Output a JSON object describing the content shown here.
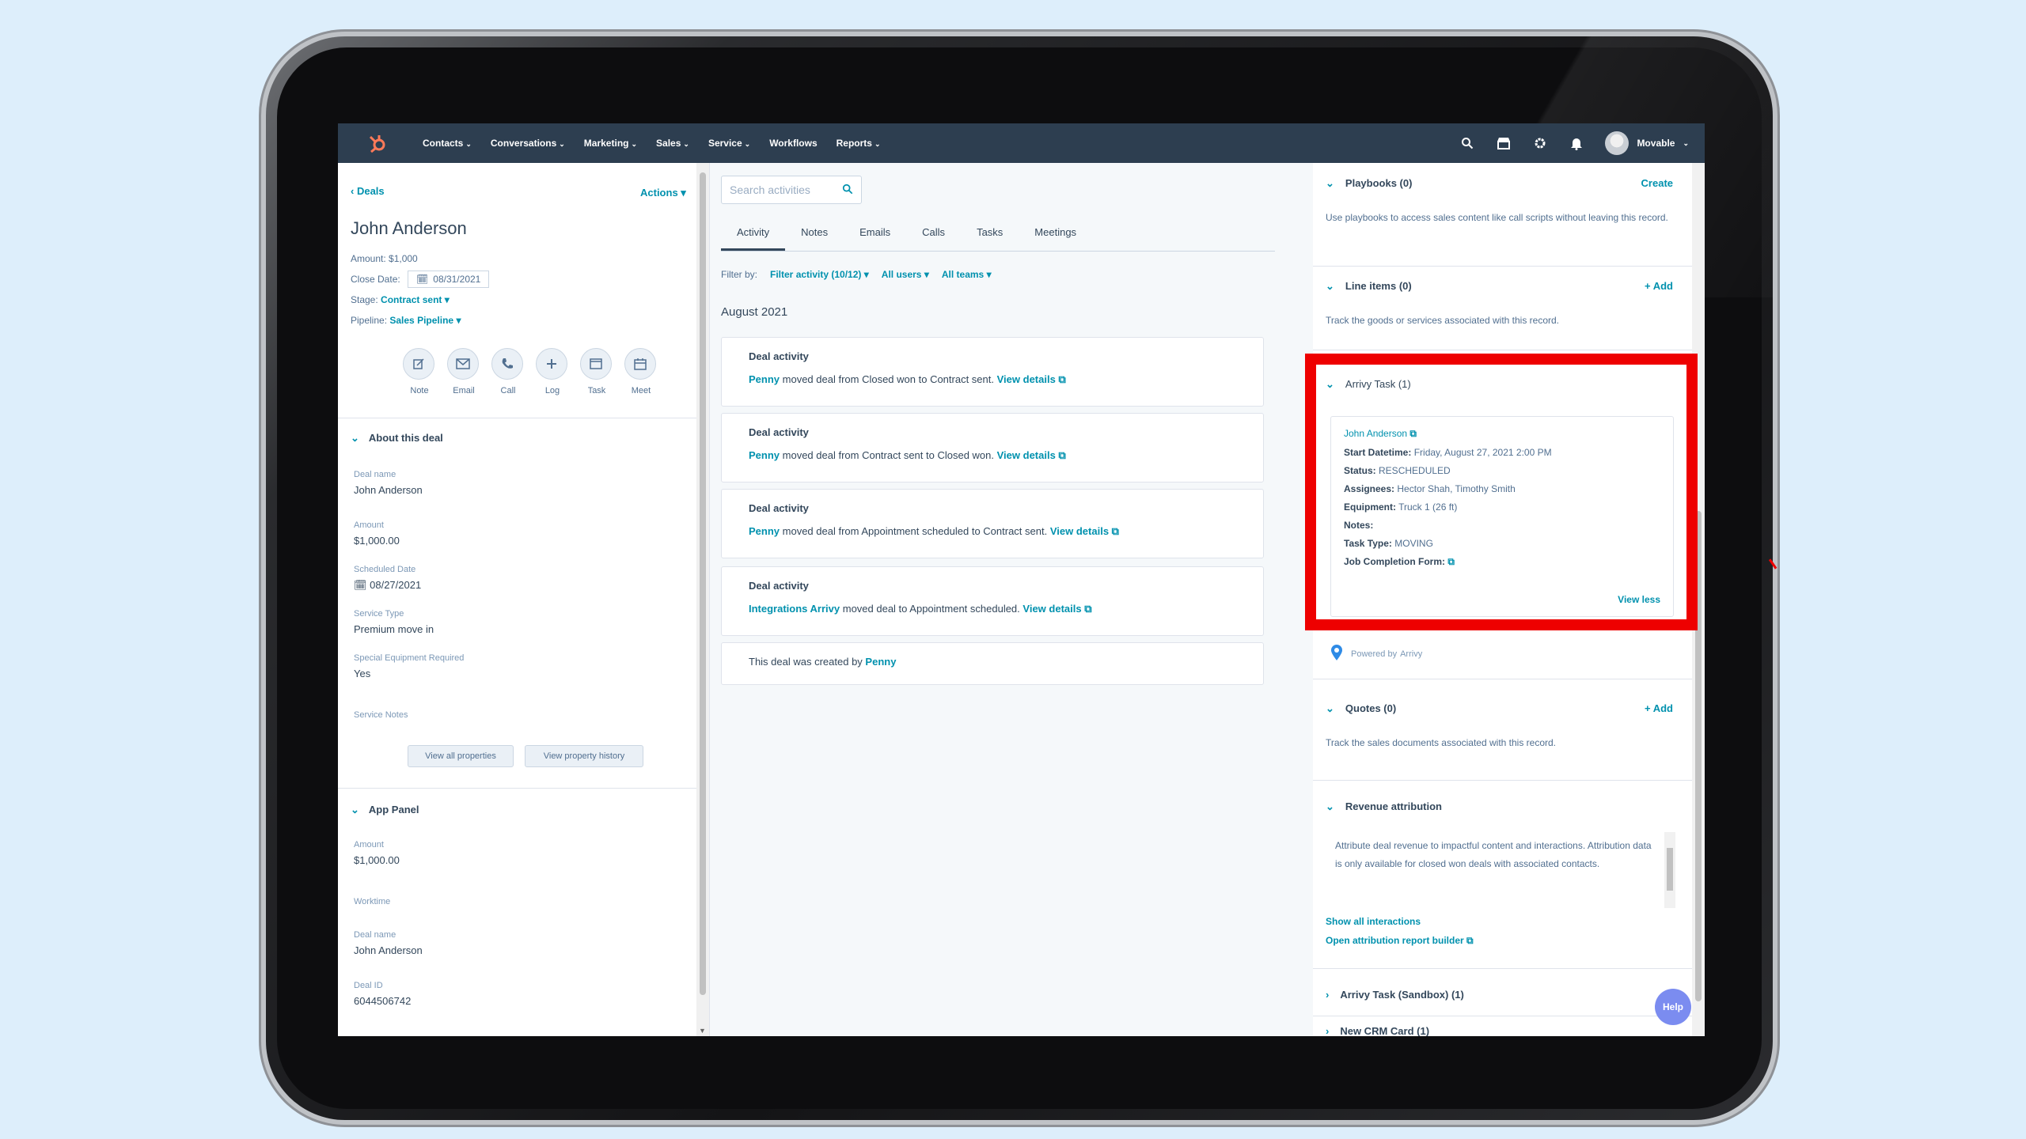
{
  "nav": {
    "items": [
      "Contacts",
      "Conversations",
      "Marketing",
      "Sales",
      "Service",
      "Workflows",
      "Reports"
    ],
    "account": "Movable"
  },
  "left": {
    "breadcrumb": "Deals",
    "actions": "Actions",
    "title": "John Anderson",
    "amount": "Amount: $1,000",
    "close_label": "Close Date:",
    "close_value": "08/31/2021",
    "stage_label": "Stage:",
    "stage_value": "Contract sent",
    "pipeline_label": "Pipeline:",
    "pipeline_value": "Sales Pipeline",
    "quick_actions": [
      "Note",
      "Email",
      "Call",
      "Log",
      "Task",
      "Meet"
    ],
    "about_title": "About this deal",
    "about_props": [
      {
        "label": "Deal name",
        "value": "John Anderson"
      },
      {
        "label": "Amount",
        "value": "$1,000.00"
      },
      {
        "label": "Scheduled Date",
        "value": "08/27/2021"
      },
      {
        "label": "Service Type",
        "value": "Premium move in"
      },
      {
        "label": "Special Equipment Required",
        "value": "Yes"
      },
      {
        "label": "Service Notes",
        "value": ""
      }
    ],
    "view_all": "View all properties",
    "view_history": "View property history",
    "app_panel_title": "App Panel",
    "app_props": [
      {
        "label": "Amount",
        "value": "$1,000.00"
      },
      {
        "label": "Worktime",
        "value": ""
      },
      {
        "label": "Deal name",
        "value": "John Anderson"
      },
      {
        "label": "Deal ID",
        "value": "6044506742"
      }
    ]
  },
  "mid": {
    "search_placeholder": "Search activities",
    "tabs": [
      "Activity",
      "Notes",
      "Emails",
      "Calls",
      "Tasks",
      "Meetings"
    ],
    "filter_label": "Filter by:",
    "filter_activity": "Filter activity (10/12)",
    "all_users": "All users",
    "all_teams": "All teams",
    "month": "August 2021",
    "activities": [
      {
        "title": "Deal activity",
        "actor": "Penny",
        "text": "moved deal from Closed won to Contract sent.",
        "link": "View details"
      },
      {
        "title": "Deal activity",
        "actor": "Penny",
        "text": "moved deal from Contract sent to Closed won.",
        "link": "View details"
      },
      {
        "title": "Deal activity",
        "actor": "Penny",
        "text": "moved deal from Appointment scheduled to Contract sent.",
        "link": "View details"
      },
      {
        "title": "Deal activity",
        "actor": "Integrations Arrivy",
        "text": "moved deal to Appointment scheduled.",
        "link": "View details"
      }
    ],
    "created_text": "This deal was created by",
    "created_by": "Penny"
  },
  "right": {
    "playbooks_title": "Playbooks (0)",
    "playbooks_action": "Create",
    "playbooks_desc": "Use playbooks to access sales content like call scripts without leaving this record.",
    "line_items_title": "Line items (0)",
    "line_items_action": "+ Add",
    "line_items_desc": "Track the goods or services associated with this record.",
    "arrivy_title": "Arrivy Task (1)",
    "task": {
      "name": "John Anderson",
      "start_label": "Start Datetime:",
      "start_value": "Friday, August 27, 2021 2:00 PM",
      "status_label": "Status:",
      "status_value": "RESCHEDULED",
      "assignees_label": "Assignees:",
      "assignees_value": "Hector Shah, Timothy Smith",
      "equipment_label": "Equipment:",
      "equipment_value": "Truck 1 (26 ft)",
      "notes_label": "Notes:",
      "type_label": "Task Type:",
      "type_value": "MOVING",
      "form_label": "Job Completion Form:",
      "view_less": "View less"
    },
    "powered_by": "Powered by",
    "powered_brand": "Arrivy",
    "quotes_title": "Quotes (0)",
    "quotes_action": "+ Add",
    "quotes_desc": "Track the sales documents associated with this record.",
    "revenue_title": "Revenue attribution",
    "revenue_desc": "Attribute deal revenue to impactful content and interactions. Attribution data is only available for closed won deals with associated contacts.",
    "show_interactions": "Show all interactions",
    "open_builder": "Open attribution report builder",
    "sandbox_title": "Arrivy Task (Sandbox) (1)",
    "crm_card_title": "New CRM Card (1)"
  },
  "help": "Help",
  "colors": {
    "nav_bg": "#2d3e50",
    "link": "#0091ae",
    "highlight": "#ee0000",
    "help": "#7b8cf0",
    "logo": "#ff7a59"
  }
}
